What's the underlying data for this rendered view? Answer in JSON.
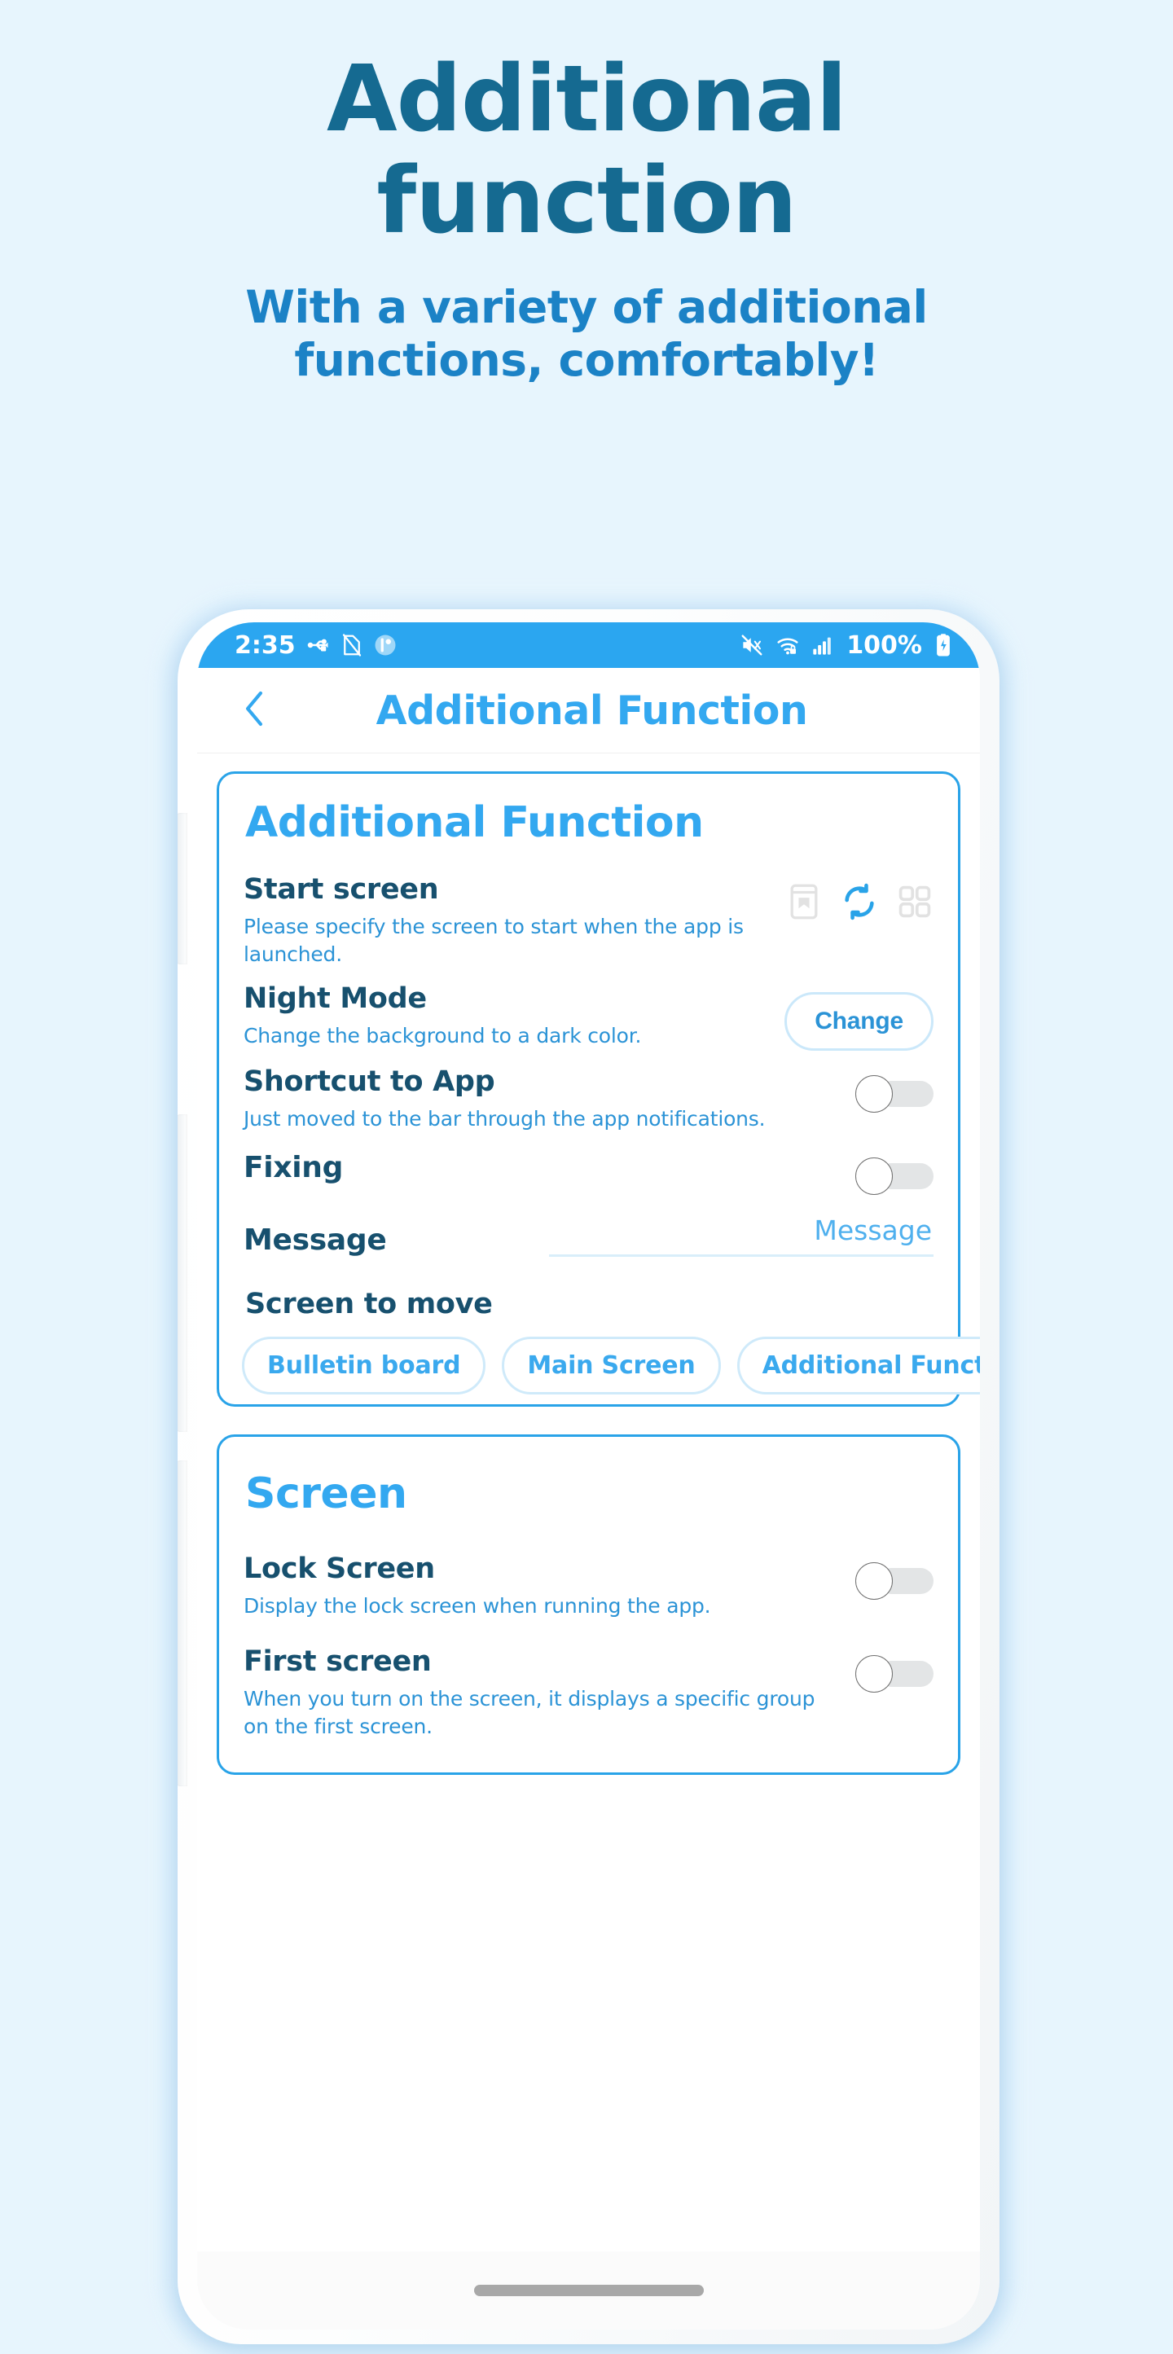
{
  "promo": {
    "title_line1": "Additional",
    "title_line2": "function",
    "subtitle_line1": "With a variety of additional",
    "subtitle_line2": "functions, comfortably!",
    "title_color": "#156A91",
    "subtitle_color": "#1B82C6",
    "background_color": "#E7F5FD"
  },
  "statusbar": {
    "time": "2:35",
    "battery_percent": "100%",
    "left_icons": [
      "usb-icon",
      "data-off-icon",
      "app-circle-icon"
    ],
    "right_icons": [
      "mute-icon",
      "wifi-lock-icon",
      "signal-icon",
      "battery-icon"
    ],
    "background_color": "#2BA6F0"
  },
  "appbar": {
    "back_icon": "chevron-left-icon",
    "title": "Additional Function",
    "title_color": "#33A8F0"
  },
  "cards": [
    {
      "id": "additional-function",
      "title": "Additional Function",
      "rows": [
        {
          "id": "start-screen",
          "title": "Start screen",
          "desc": "Please specify the screen to start when the app is launched.",
          "control": "icon-trio",
          "icons": [
            {
              "name": "bookmark-board-icon",
              "selected": false
            },
            {
              "name": "refresh-sync-icon",
              "selected": true
            },
            {
              "name": "grid-four-icon",
              "selected": false
            }
          ]
        },
        {
          "id": "night-mode",
          "title": "Night Mode",
          "desc": "Change the background to a dark color.",
          "control": "button",
          "button_label": "Change"
        },
        {
          "id": "shortcut-to-app",
          "title": "Shortcut to App",
          "desc": "Just moved to the bar through the app notifications.",
          "control": "toggle",
          "toggle_on": false
        },
        {
          "id": "fixing",
          "title": "Fixing",
          "desc": "",
          "control": "toggle",
          "toggle_on": false
        }
      ],
      "message": {
        "label": "Message",
        "value": "",
        "placeholder": "Message"
      },
      "screen_to_move": {
        "label": "Screen to move",
        "chips": [
          "Bulletin board",
          "Main Screen",
          "Additional Function"
        ]
      }
    },
    {
      "id": "screen",
      "title": "Screen",
      "rows": [
        {
          "id": "lock-screen",
          "title": "Lock Screen",
          "desc": "Display the lock screen when running the app.",
          "control": "toggle",
          "toggle_on": false
        },
        {
          "id": "first-screen",
          "title": "First screen",
          "desc": "When you turn on the screen, it displays a specific group on the first screen.",
          "control": "toggle",
          "toggle_on": false
        }
      ]
    }
  ],
  "colors": {
    "accent": "#33A8F0",
    "card_border": "#29A3E8",
    "row_title": "#17506E",
    "row_desc": "#2B93D6"
  }
}
